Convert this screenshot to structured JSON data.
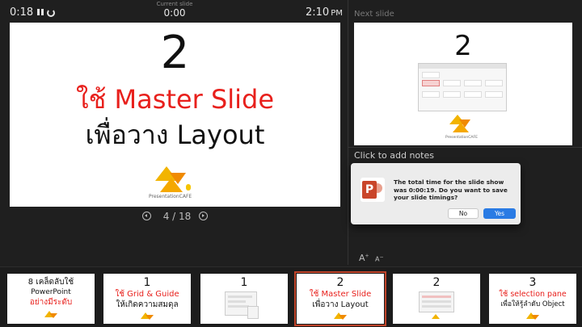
{
  "top_bar": {
    "elapsed": "0:18",
    "current_slide_label": "Current slide",
    "current_slide_time": "0:00",
    "clock_time": "2:10",
    "clock_ampm": "PM"
  },
  "current_slide": {
    "number": "2",
    "title_red": "ใช้ Master Slide",
    "title_black": "เพื่อวาง Layout",
    "logo_text": "PresentationCAFE"
  },
  "navigation": {
    "counter": "4 / 18"
  },
  "next_slide": {
    "label": "Next slide",
    "number": "2",
    "logo_text": "PresentationCAFE"
  },
  "notes": {
    "placeholder": "Click to add notes"
  },
  "dialog": {
    "message": "The total time for the slide show was 0:00:19. Do you want to save your slide timings?",
    "no_label": "No",
    "yes_label": "Yes"
  },
  "font_controls": {
    "increase": "A",
    "decrease": "A"
  },
  "thumbnails": [
    {
      "line1": "8 เคล็ดลับใช้",
      "line2": "PowerPoint",
      "line3": "อย่างมีระดับ"
    },
    {
      "line1": "1",
      "line2": "ใช้ Grid & Guide",
      "line3": "ให้เกิดความสมดุล"
    },
    {
      "line1": "1"
    },
    {
      "line1": "2",
      "line2": "ใช้ Master Slide",
      "line3": "เพื่อวาง Layout"
    },
    {
      "line1": "2"
    },
    {
      "line1": "3",
      "line2": "ใช้ selection pane",
      "line3": "เพื่อให้รู้ลำดับ Object"
    }
  ],
  "colors": {
    "background": "#1f1f1f",
    "accent_red": "#e8201c",
    "active_thumb_border": "#c0442a",
    "dialog_yes": "#2a7be4",
    "logo_yellow": "#f2b400"
  },
  "icons": [
    "pause-icon",
    "reset-icon",
    "prev-slide-icon",
    "next-slide-icon",
    "powerpoint-app-icon"
  ]
}
